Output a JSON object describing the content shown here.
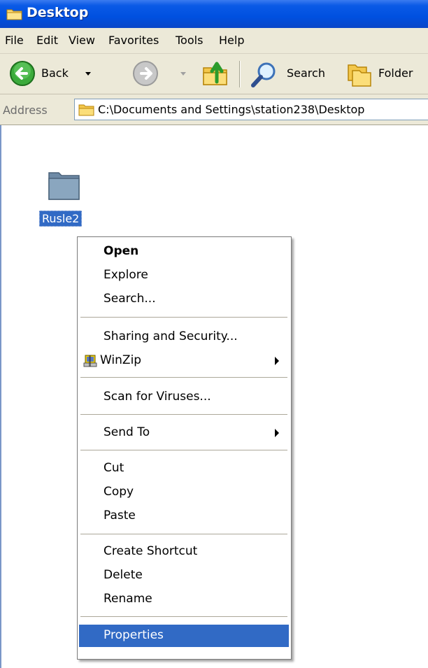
{
  "window": {
    "title": "Desktop",
    "title_icon": "folder-icon"
  },
  "menubar": {
    "items": [
      "File",
      "Edit",
      "View",
      "Favorites",
      "Tools",
      "Help"
    ]
  },
  "toolbar": {
    "back_label": "Back",
    "search_label": "Search",
    "folders_label": "Folder"
  },
  "addressbar": {
    "label": "Address",
    "value": "C:\\Documents and Settings\\station238\\Desktop"
  },
  "desktop": {
    "item_label": "Rusle2"
  },
  "context_menu": {
    "items": [
      {
        "label": "Open",
        "bold": true
      },
      {
        "label": "Explore"
      },
      {
        "label": "Search..."
      },
      {
        "label": "Sharing and Security..."
      },
      {
        "label": "WinZip",
        "submenu": true,
        "icon": "winzip-icon"
      },
      {
        "label": "Scan for Viruses..."
      },
      {
        "label": "Send To",
        "submenu": true
      },
      {
        "label": "Cut"
      },
      {
        "label": "Copy"
      },
      {
        "label": "Paste"
      },
      {
        "label": "Create Shortcut"
      },
      {
        "label": "Delete"
      },
      {
        "label": "Rename"
      },
      {
        "label": "Properties",
        "selected": true
      }
    ]
  },
  "colors": {
    "titlebar": "#0a5ae6",
    "chrome": "#ece9d8",
    "selection": "#316ac5"
  }
}
